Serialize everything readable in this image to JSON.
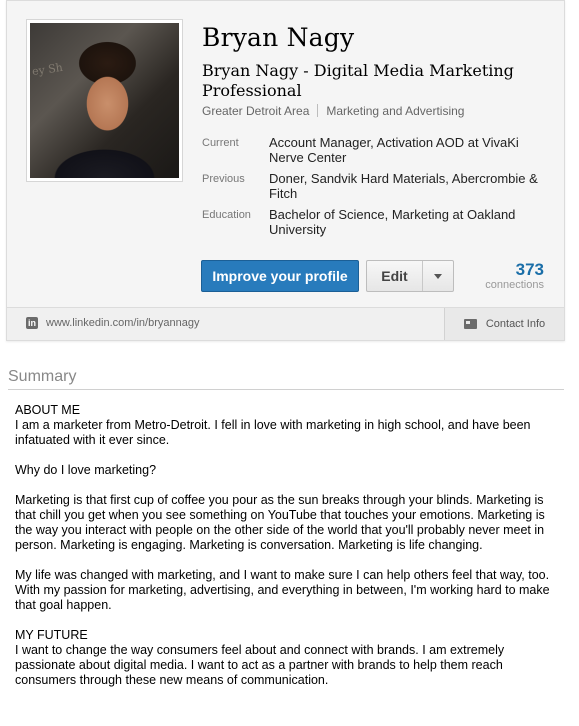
{
  "profile": {
    "name": "Bryan Nagy",
    "headline": "Bryan Nagy - Digital Media Marketing Professional",
    "location": "Greater Detroit Area",
    "industry": "Marketing and Advertising",
    "photo_sign_text": "ey Sh"
  },
  "facts": [
    {
      "label": "Current",
      "value": "Account Manager, Activation AOD at VivaKi Nerve Center"
    },
    {
      "label": "Previous",
      "value": "Doner, Sandvik Hard Materials, Abercrombie & Fitch"
    },
    {
      "label": "Education",
      "value": "Bachelor of Science, Marketing at Oakland University"
    }
  ],
  "actions": {
    "improve_label": "Improve your profile",
    "edit_label": "Edit"
  },
  "connections": {
    "count": "373",
    "label": "connections"
  },
  "footer": {
    "url": "www.linkedin.com/in/bryannagy",
    "contact_label": "Contact Info"
  },
  "summary": {
    "title": "Summary",
    "paragraphs": [
      "ABOUT ME\nI am a marketer from Metro-Detroit. I fell in love with marketing in high school, and have been infatuated with it ever since.",
      "Why do I love marketing?",
      "Marketing is that first cup of coffee you pour as the sun breaks through your blinds. Marketing is that chill you get when you see something on YouTube that touches your emotions. Marketing is the way you interact with people on the other side of the world that you'll probably never meet in person. Marketing is engaging. Marketing is conversation. Marketing is life changing.",
      "My life was changed with marketing, and I want to make sure I can help others feel that way, too. With my passion for marketing, advertising, and everything in between, I'm working hard to make that goal happen.",
      "MY FUTURE\nI want to change the way consumers feel about and connect with brands. I am extremely passionate about digital media. I want to act as a partner with brands to help them reach consumers through these new means of communication."
    ]
  },
  "colors": {
    "primary_button": "#287bbc",
    "connections_count": "#1a6ea8"
  },
  "icons": [
    "linkedin-icon",
    "contact-card-icon",
    "chevron-down-icon"
  ]
}
